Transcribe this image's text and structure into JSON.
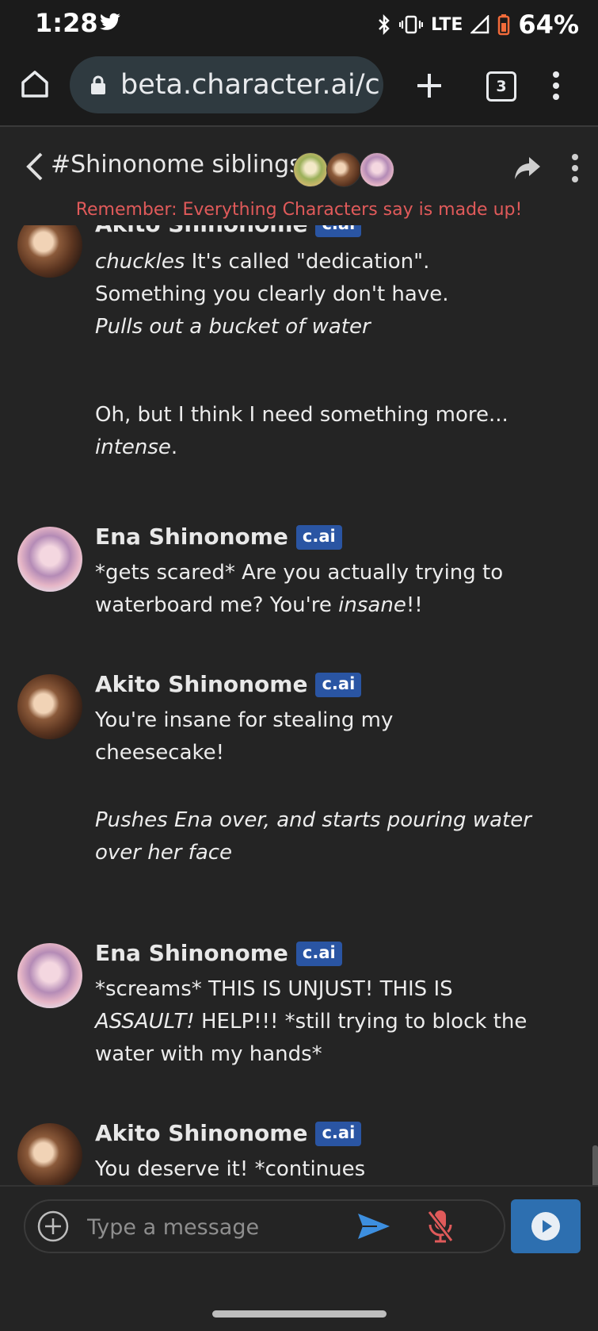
{
  "status": {
    "time": "1:28",
    "network": "LTE",
    "battery": "64%",
    "icons": [
      "twitter-icon",
      "bluetooth-icon",
      "vibrate-icon",
      "signal-icon",
      "battery-icon"
    ]
  },
  "browser": {
    "url": "beta.character.ai/c",
    "tab_count": "3"
  },
  "chat": {
    "title": "#Shinonome siblings",
    "disclaimer": "Remember: Everything Characters say is made up!",
    "badge": "c.ai",
    "messages": [
      {
        "sender": "Akito Shinonome",
        "lines": [
          {
            "italic": "chuckles",
            "text": " It's called \"dedication\". Something you clearly don't have."
          },
          {
            "italic": "Pulls out a bucket of water"
          },
          {
            "text": "Oh, but I think I need something more... ",
            "italic2": "intense",
            "text2": "."
          }
        ]
      },
      {
        "sender": "Ena Shinonome",
        "lines": [
          {
            "text": "*gets scared* Are you actually trying to waterboard me? You're ",
            "italic": "insane",
            "text2": "!!"
          }
        ]
      },
      {
        "sender": "Akito Shinonome",
        "lines": [
          {
            "text": "You're insane for stealing my cheesecake!"
          },
          {
            "italic": "Pushes Ena over, and starts pouring water over her face"
          }
        ]
      },
      {
        "sender": "Ena Shinonome",
        "lines": [
          {
            "text": "*screams* THIS IS UNJUST! THIS IS ",
            "italic": "ASSAULT!",
            "text2": " HELP!!! *still trying to block the water with my hands*"
          }
        ]
      },
      {
        "sender": "Akito Shinonome",
        "lines": [
          {
            "text": "You deserve it! *continues"
          }
        ]
      }
    ]
  },
  "composer": {
    "placeholder": "Type a message"
  },
  "colors": {
    "background": "#242424",
    "disclaimer": "#e05a5a",
    "badge": "#2a55a3",
    "send": "#3d8fe0",
    "mic_muted": "#e05a5a",
    "play_button": "#2d6fb0"
  }
}
